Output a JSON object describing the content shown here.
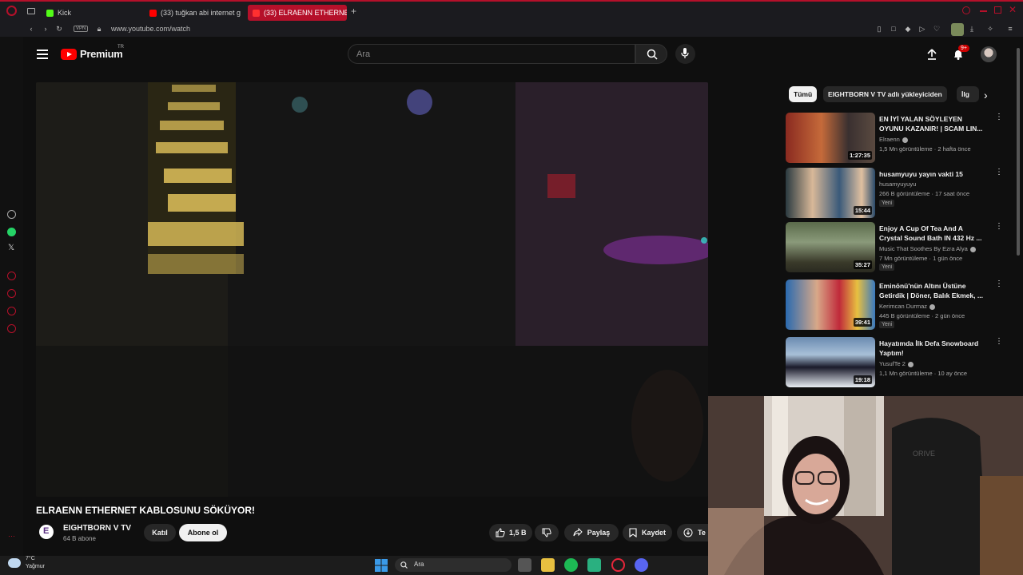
{
  "browser": {
    "tabs": [
      {
        "label": "Kick",
        "active": false,
        "color": "#53fc18"
      },
      {
        "label": "(33) tuğkan abi internet g",
        "active": false,
        "color": "#ff0000"
      },
      {
        "label": "(33) ELRAENN ETHERNET",
        "active": true,
        "color": "#ff0000"
      }
    ],
    "vpn_label": "VPN",
    "url": "www.youtube.com/watch"
  },
  "youtube": {
    "logo_text": "Premium",
    "region": "TR",
    "search_placeholder": "Ara",
    "notifications_badge": "9+",
    "video": {
      "title": "ELRAENN ETHERNET KABLOSUNU SÖKÜYOR!",
      "channel": "EIGHTBORN V TV",
      "subscribers": "64 B abone",
      "join_label": "Katıl",
      "subscribe_label": "Abone ol",
      "likes": "1,5 B",
      "share_label": "Paylaş",
      "save_label": "Kaydet",
      "more_label": "Te"
    },
    "chips": [
      "Tümü",
      "EIGHTBORN V TV adlı yükleyiciden",
      "İlg"
    ],
    "recommendations": [
      {
        "title": "EN İYİ YALAN SÖYLEYEN OYUNU KAZANIR! | SCAM LIN...",
        "channel": "Elraenn",
        "verified": true,
        "meta": "1,5 Mn görüntüleme · 2 hafta önce",
        "duration": "1:27:35",
        "badge": ""
      },
      {
        "title": "husamyuyu yayın vakti 15",
        "channel": "husamyuyuyu",
        "verified": false,
        "meta": "266 B görüntüleme · 17 saat önce",
        "duration": "15:44",
        "badge": "Yeni"
      },
      {
        "title": "Enjoy A Cup Of Tea And A Crystal Sound Bath IN 432 Hz ...",
        "channel": "Music That Soothes By Ezra Alya",
        "verified": true,
        "meta": "7 Mn görüntüleme · 1 gün önce",
        "duration": "35:27",
        "badge": "Yeni"
      },
      {
        "title": "Eminönü'nün Altını Üstüne Getirdik | Döner, Balık Ekmek, ...",
        "channel": "Kerimcan Durmaz",
        "verified": true,
        "meta": "445 B görüntüleme · 2 gün önce",
        "duration": "39:41",
        "badge": "Yeni"
      },
      {
        "title": "Hayatımda İlk Defa Snowboard Yaptım!",
        "channel": "YusufTe 2",
        "verified": true,
        "meta": "1,1 Mn görüntüleme · 10 ay önce",
        "duration": "19:18",
        "badge": ""
      }
    ]
  },
  "taskbar": {
    "temperature": "7°C",
    "condition": "Yağmur",
    "search_label": "Ara"
  },
  "colors": {
    "opera_red": "#b5102a",
    "youtube_red": "#ff0000",
    "background": "#0f0f0f"
  }
}
